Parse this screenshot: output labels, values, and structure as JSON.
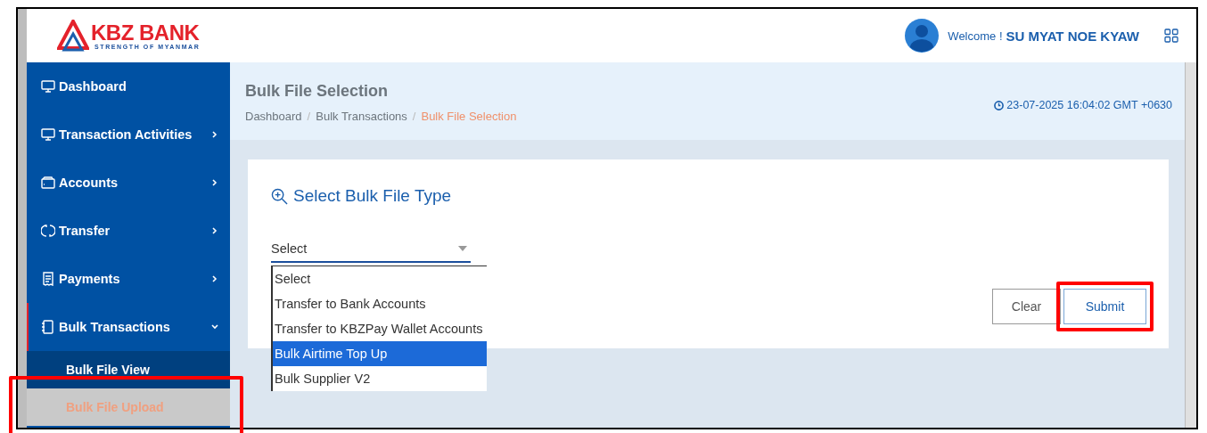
{
  "header": {
    "logo": {
      "name": "KBZ BANK",
      "tagline": "STRENGTH OF MYANMAR"
    },
    "welcome": "Welcome !",
    "user": "SU MYAT NOE KYAW"
  },
  "sidebar": {
    "items": [
      {
        "label": "Dashboard",
        "kind": "link",
        "active": false
      },
      {
        "label": "Transaction Activities",
        "kind": "group",
        "expanded": false,
        "active": false
      },
      {
        "label": "Accounts",
        "kind": "group",
        "expanded": false,
        "active": false
      },
      {
        "label": "Transfer",
        "kind": "group",
        "expanded": false,
        "active": false
      },
      {
        "label": "Payments",
        "kind": "group",
        "expanded": false,
        "active": false
      },
      {
        "label": "Bulk Transactions",
        "kind": "group",
        "expanded": true,
        "active": true,
        "children": [
          {
            "label": "Bulk File View",
            "selected": false,
            "highlighted": false
          },
          {
            "label": "Bulk File Upload",
            "selected": true,
            "highlighted": true
          }
        ]
      }
    ]
  },
  "page": {
    "title": "Bulk File Selection",
    "breadcrumb": [
      {
        "kind": "link",
        "label": "Dashboard",
        "current": false
      },
      {
        "kind": "separator",
        "label": "/"
      },
      {
        "kind": "link",
        "label": "Bulk Transactions",
        "current": false
      },
      {
        "kind": "separator",
        "label": "/"
      },
      {
        "kind": "link",
        "label": "Bulk File Selection",
        "current": true
      }
    ],
    "timestamp": "23-07-2025 16:04:02 GMT +0630"
  },
  "card": {
    "heading": "Select Bulk File Type",
    "select": {
      "value": "Select",
      "options": [
        {
          "label": "Select",
          "highlighted": false
        },
        {
          "label": "Transfer to Bank Accounts",
          "highlighted": false
        },
        {
          "label": "Transfer to KBZPay Wallet Accounts",
          "highlighted": false
        },
        {
          "label": "Bulk Airtime Top Up",
          "highlighted": true
        },
        {
          "label": "Bulk Supplier V2",
          "highlighted": false
        }
      ]
    },
    "buttons": [
      {
        "label": "Clear",
        "kind": "secondary",
        "highlighted": false
      },
      {
        "label": "Submit",
        "kind": "primary",
        "highlighted": true
      }
    ]
  }
}
